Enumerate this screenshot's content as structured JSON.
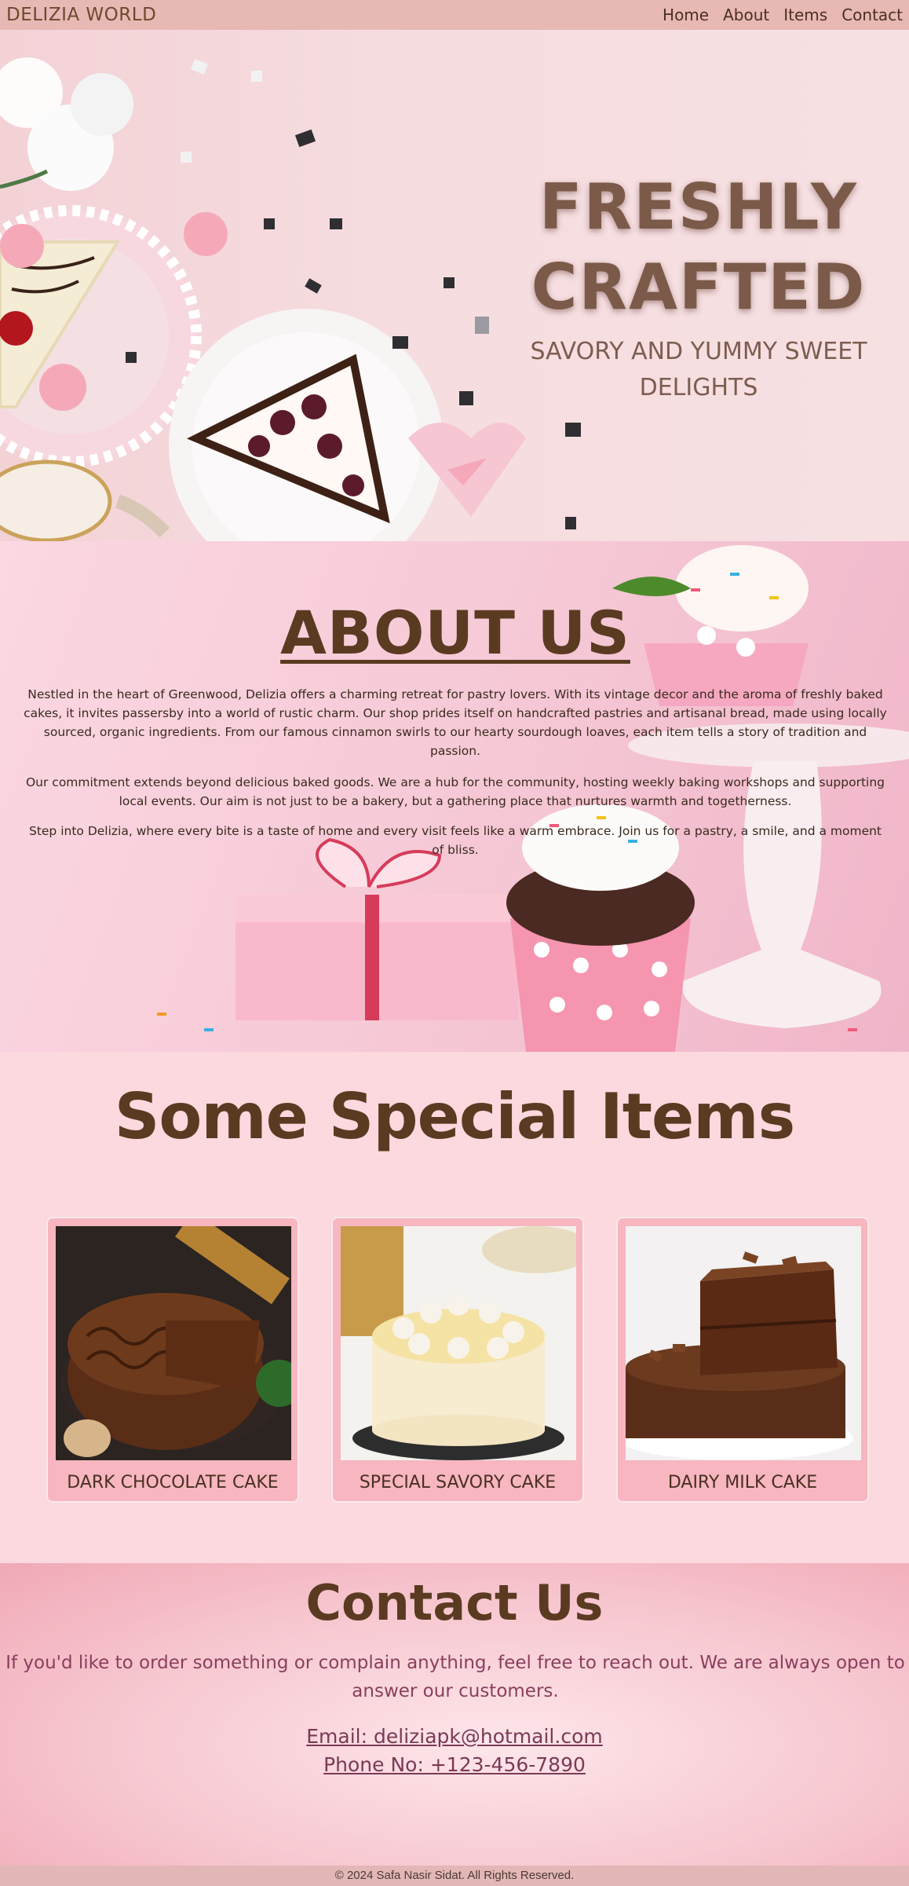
{
  "nav": {
    "brand": "DELIZIA WORLD",
    "links": [
      "Home",
      "About",
      "Items",
      "Contact"
    ]
  },
  "hero": {
    "title_line1": "FRESHLY",
    "title_line2": "CRAFTED",
    "subtitle_line1": "SAVORY AND YUMMY SWEET",
    "subtitle_line2": "DELIGHTS"
  },
  "about": {
    "title": "ABOUT US",
    "paragraphs": [
      "Nestled in the heart of Greenwood, Delizia offers a charming retreat for pastry lovers. With its vintage decor and the aroma of freshly baked cakes, it invites passersby into a world of rustic charm. Our shop prides itself on handcrafted pastries and artisanal bread, made using locally sourced, organic ingredients. From our famous cinnamon swirls to our hearty sourdough loaves, each item tells a story of tradition and passion.",
      "Our commitment extends beyond delicious baked goods. We are a hub for the community, hosting weekly baking workshops and supporting local events. Our aim is not just to be a bakery, but a gathering place that nurtures warmth and togetherness.",
      "Step into Delizia, where every bite is a taste of home and every visit feels like a warm embrace. Join us for a pastry, a smile, and a moment of bliss."
    ]
  },
  "items": {
    "title": "Some Special Items",
    "cards": [
      {
        "label": "DARK CHOCOLATE CAKE"
      },
      {
        "label": "SPECIAL SAVORY CAKE"
      },
      {
        "label": "DAIRY MILK CAKE"
      }
    ]
  },
  "contact": {
    "title": "Contact Us",
    "text": "If you'd like to order something or complain anything, feel free to reach out. We are always open to answer our customers.",
    "email": "Email: deliziapk@hotmail.com",
    "phone": "Phone No: +123-456-7890"
  },
  "footer": {
    "text": "© 2024 Safa Nasir Sidat. All Rights Reserved."
  }
}
